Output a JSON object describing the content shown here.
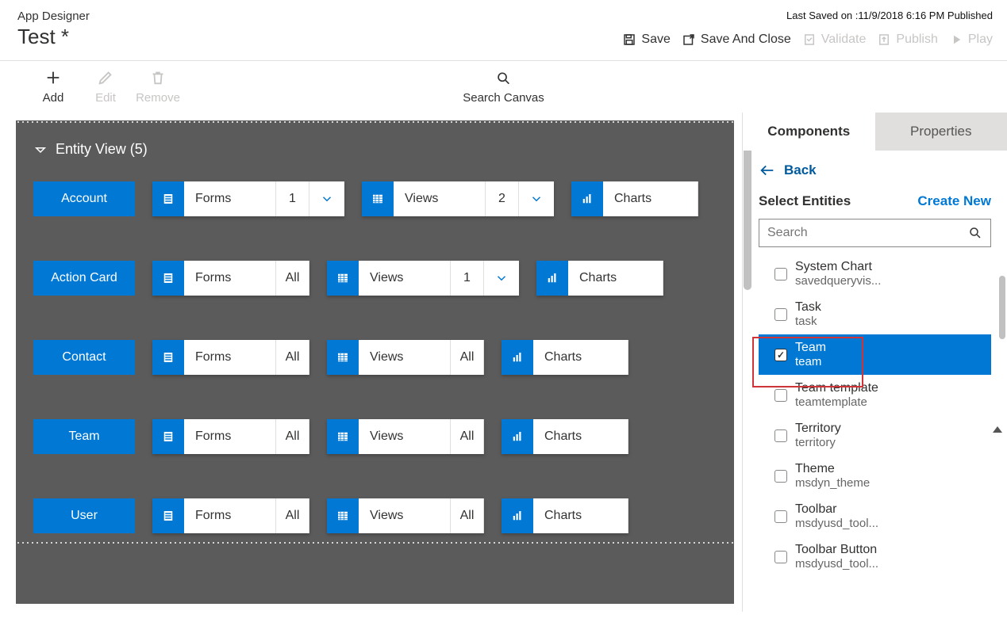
{
  "header": {
    "app_label": "App Designer",
    "title": "Test *",
    "last_saved": "Last Saved on :11/9/2018 6:16 PM Published",
    "actions": {
      "save": "Save",
      "save_close": "Save And Close",
      "validate": "Validate",
      "publish": "Publish",
      "play": "Play"
    }
  },
  "toolbar": {
    "add": "Add",
    "edit": "Edit",
    "remove": "Remove",
    "search_canvas": "Search Canvas"
  },
  "canvas": {
    "section_title": "Entity View (5)",
    "rows": [
      {
        "name": "Account",
        "forms_count": "1",
        "forms_chev": true,
        "views_count": "2",
        "views_chev": true
      },
      {
        "name": "Action Card",
        "forms_count": "All",
        "forms_chev": false,
        "views_count": "1",
        "views_chev": true
      },
      {
        "name": "Contact",
        "forms_count": "All",
        "forms_chev": false,
        "views_count": "All",
        "views_chev": false
      },
      {
        "name": "Team",
        "forms_count": "All",
        "forms_chev": false,
        "views_count": "All",
        "views_chev": false
      },
      {
        "name": "User",
        "forms_count": "All",
        "forms_chev": false,
        "views_count": "All",
        "views_chev": false
      }
    ],
    "labels": {
      "forms": "Forms",
      "views": "Views",
      "charts": "Charts"
    }
  },
  "panel": {
    "tabs": {
      "components": "Components",
      "properties": "Properties"
    },
    "back": "Back",
    "select_entities": "Select Entities",
    "create_new": "Create New",
    "search_placeholder": "Search",
    "entities": [
      {
        "name": "System Chart",
        "schema": "savedqueryvis...",
        "selected": false
      },
      {
        "name": "Task",
        "schema": "task",
        "selected": false
      },
      {
        "name": "Team",
        "schema": "team",
        "selected": true
      },
      {
        "name": "Team template",
        "schema": "teamtemplate",
        "selected": false
      },
      {
        "name": "Territory",
        "schema": "territory",
        "selected": false
      },
      {
        "name": "Theme",
        "schema": "msdyn_theme",
        "selected": false
      },
      {
        "name": "Toolbar",
        "schema": "msdyusd_tool...",
        "selected": false
      },
      {
        "name": "Toolbar Button",
        "schema": "msdyusd_tool...",
        "selected": false
      }
    ]
  }
}
